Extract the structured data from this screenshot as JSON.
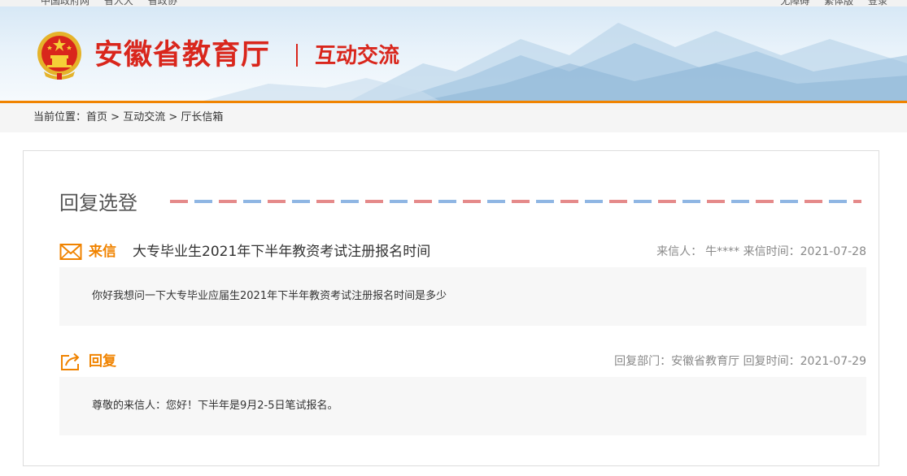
{
  "top_nav": {
    "left_links": [
      "中国政府网",
      "省人大",
      "省政协"
    ],
    "right_links": [
      "无障碍",
      "繁体版",
      "登录"
    ]
  },
  "header": {
    "site_title": "安徽省教育厅",
    "section_title": "互动交流",
    "emblem_icon": "national-emblem"
  },
  "breadcrumb": {
    "prefix": "当前位置：",
    "items": [
      "首页",
      "互动交流",
      "厅长信箱"
    ],
    "separator": " > "
  },
  "content": {
    "heading": "回复选登",
    "letter": {
      "tag": "来信",
      "icon": "envelope-icon",
      "subject": "大专毕业生2021年下半年教资考试注册报名时间",
      "sender_label": "来信人：",
      "sender": "牛****",
      "date_label": "来信时间：",
      "date": "2021-07-28",
      "body": "你好我想问一下大专毕业应届生2021年下半年教资考试注册报名时间是多少"
    },
    "reply": {
      "tag": "回复",
      "icon": "share-reply-icon",
      "dept_label": "回复部门：",
      "dept": "安徽省教育厅",
      "date_label": "回复时间：",
      "date": "2021-07-29",
      "body": "尊敬的来信人：您好！下半年是9月2-5日笔试报名。"
    }
  },
  "colors": {
    "brand_red": "#d9261c",
    "accent_orange": "#f08300",
    "airmail_red": "#e58a8a",
    "airmail_blue": "#8fb6e3"
  }
}
